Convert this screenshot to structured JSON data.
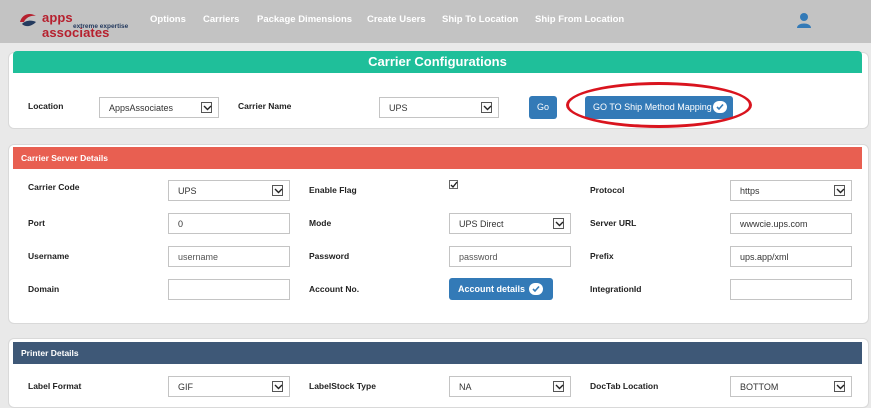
{
  "brand": {
    "name": "apps associates",
    "tagline": "extreme expertise"
  },
  "nav": [
    "Options",
    "Carriers",
    "Package Dimensions",
    "Create Users",
    "Ship To Location",
    "Ship From Location"
  ],
  "config": {
    "title": "Carrier Configurations",
    "location_label": "Location",
    "location_value": "AppsAssociates",
    "carrier_name_label": "Carrier Name",
    "carrier_name_value": "UPS",
    "go_label": "Go",
    "map_label": "GO TO Ship Method Mapping"
  },
  "server": {
    "title": "Carrier Server Details",
    "carrier_code_label": "Carrier Code",
    "carrier_code_value": "UPS",
    "enable_flag_label": "Enable Flag",
    "enable_flag_checked": true,
    "protocol_label": "Protocol",
    "protocol_value": "https",
    "port_label": "Port",
    "port_value": "0",
    "mode_label": "Mode",
    "mode_value": "UPS Direct",
    "server_url_label": "Server URL",
    "server_url_value": "wwwcie.ups.com",
    "username_label": "Username",
    "username_placeholder": "username",
    "password_label": "Password",
    "password_placeholder": "password",
    "prefix_label": "Prefix",
    "prefix_value": "ups.app/xml",
    "domain_label": "Domain",
    "domain_value": "",
    "account_no_label": "Account No.",
    "account_details_label": "Account details",
    "integration_id_label": "IntegrationId",
    "integration_id_value": ""
  },
  "printer": {
    "title": "Printer Details",
    "label_format_label": "Label Format",
    "label_format_value": "GIF",
    "labelstock_label": "LabelStock Type",
    "labelstock_value": "NA",
    "doctab_label": "DocTab Location",
    "doctab_value": "BOTTOM"
  },
  "colors": {
    "topbar": "#c3c3c3",
    "config_band": "#1fbf9a",
    "server_band": "#e85f51",
    "printer_band": "#3e5877",
    "button": "#337ab7",
    "highlight_ellipse": "#d9141e"
  }
}
